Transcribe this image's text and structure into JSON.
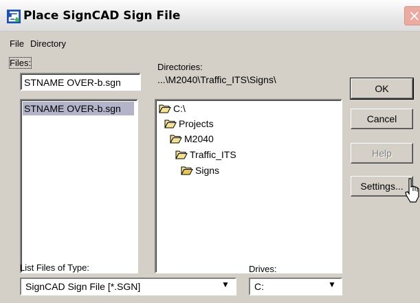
{
  "window": {
    "title": "Place SignCAD Sign File",
    "close_glyph": "×",
    "app_icon": "signcad-app-icon"
  },
  "menubar": {
    "items": [
      {
        "label": "File"
      },
      {
        "label": "Directory"
      }
    ]
  },
  "files": {
    "label": "Files:",
    "filename_value": "STNAME OVER-b.sgn",
    "list_items": [
      "STNAME OVER-b.sgn"
    ],
    "selected_index": 0
  },
  "directories": {
    "label": "Directories:",
    "current_path": "...\\M2040\\Traffic_ITS\\Signs\\",
    "tree": [
      {
        "label": "C:\\",
        "icon": "open-folder-icon"
      },
      {
        "label": "Projects",
        "icon": "open-folder-icon"
      },
      {
        "label": "M2040",
        "icon": "open-folder-icon"
      },
      {
        "label": "Traffic_ITS",
        "icon": "open-folder-icon"
      },
      {
        "label": "Signs",
        "icon": "open-folder-icon"
      }
    ]
  },
  "buttons": {
    "ok": "OK",
    "cancel": "Cancel",
    "help": "Help",
    "settings": "Settings..."
  },
  "file_type": {
    "label": "List Files of Type:",
    "selected": "SignCAD Sign File [*.SGN]"
  },
  "drives": {
    "label": "Drives:",
    "selected": "C:"
  },
  "colors": {
    "dialog_bg": "#d4d0c8",
    "selection_bg": "#b3b3c9",
    "close_btn": "#ecaaa0",
    "folder": "#f6e48a"
  }
}
